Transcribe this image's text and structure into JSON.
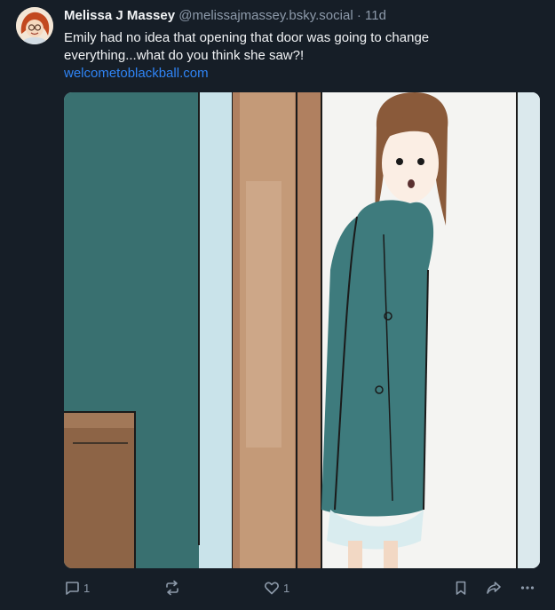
{
  "post": {
    "author_name": "Melissa J Massey",
    "handle": "@melissajmassey.bsky.social",
    "separator": "·",
    "time": "11d",
    "text": "Emily had no idea that opening that door was going to change everything...what do you think she saw?!",
    "link": "welcometoblackball.com",
    "image_alt": "Illustration of a girl in a teal coat peeking out from behind a wooden door frame"
  },
  "actions": {
    "reply_count": "1",
    "like_count": "1",
    "icons": {
      "reply": "speech-bubble-icon",
      "repost": "repost-arrows-icon",
      "like": "heart-icon",
      "bookmark": "bookmark-icon",
      "share": "share-arrow-icon",
      "more": "ellipsis-icon"
    }
  },
  "colors": {
    "background": "#161e27",
    "text": "#f1f3f5",
    "muted": "#8d9aaa",
    "link": "#2f84f5"
  }
}
